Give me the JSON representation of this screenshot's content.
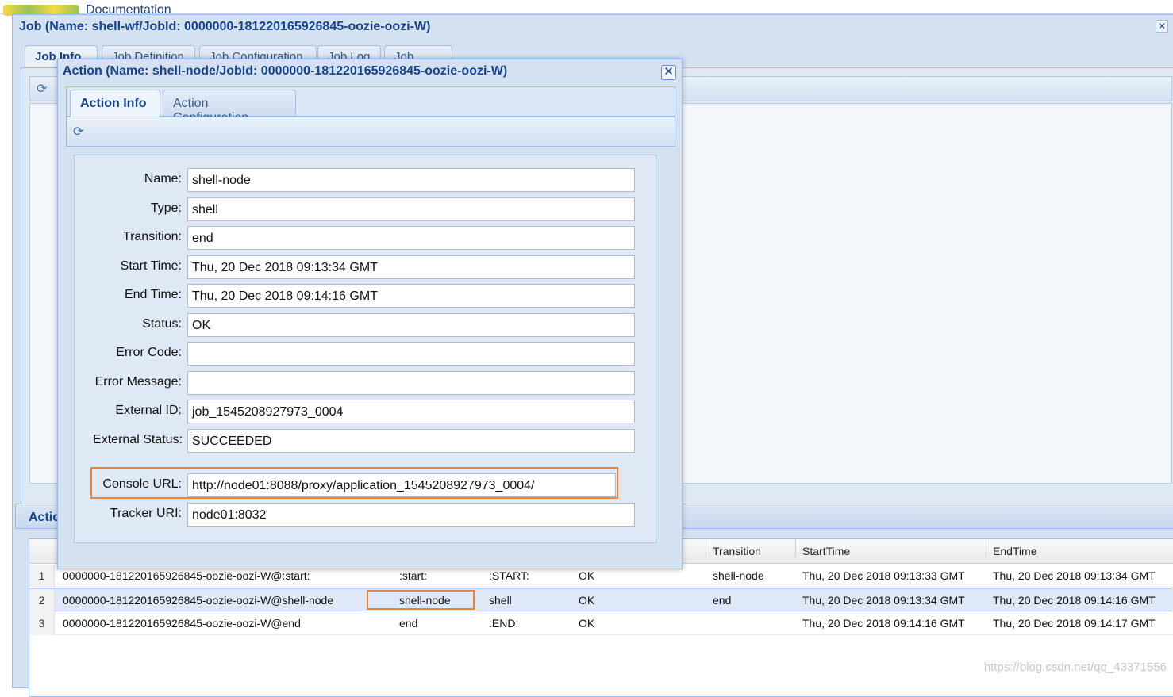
{
  "top": {
    "doc_label": "Documentation"
  },
  "job_window": {
    "title": "Job (Name: shell-wf/JobId: 0000000-181220165926845-oozie-oozi-W)",
    "tabs": [
      "Job Info",
      "Job Definition",
      "Job Configuration",
      "Job Log",
      "Job DAG"
    ],
    "active_tab": "Job Info",
    "actions_panel_title": "Actions",
    "grid": {
      "visible_columns": [
        "Transition",
        "StartTime",
        "EndTime"
      ],
      "rows": [
        {
          "n": "1",
          "id": "0000000-181220165926845-oozie-oozi-W@:start:",
          "name": ":start:",
          "type": ":START:",
          "status": "OK",
          "transition": "shell-node",
          "start": "Thu, 20 Dec 2018 09:13:33 GMT",
          "end": "Thu, 20 Dec 2018 09:13:34 GMT"
        },
        {
          "n": "2",
          "id": "0000000-181220165926845-oozie-oozi-W@shell-node",
          "name": "shell-node",
          "type": "shell",
          "status": "OK",
          "transition": "end",
          "start": "Thu, 20 Dec 2018 09:13:34 GMT",
          "end": "Thu, 20 Dec 2018 09:14:16 GMT"
        },
        {
          "n": "3",
          "id": "0000000-181220165926845-oozie-oozi-W@end",
          "name": "end",
          "type": ":END:",
          "status": "OK",
          "transition": "",
          "start": "Thu, 20 Dec 2018 09:14:16 GMT",
          "end": "Thu, 20 Dec 2018 09:14:17 GMT"
        }
      ]
    }
  },
  "action_dialog": {
    "title": "Action (Name: shell-node/JobId: 0000000-181220165926845-oozie-oozi-W)",
    "tabs": [
      "Action Info",
      "Action Configuration"
    ],
    "active_tab": "Action Info",
    "fields": [
      {
        "label": "Name:",
        "value": "shell-node"
      },
      {
        "label": "Type:",
        "value": "shell"
      },
      {
        "label": "Transition:",
        "value": "end"
      },
      {
        "label": "Start Time:",
        "value": "Thu, 20 Dec 2018 09:13:34 GMT"
      },
      {
        "label": "End Time:",
        "value": "Thu, 20 Dec 2018 09:14:16 GMT"
      },
      {
        "label": "Status:",
        "value": "OK"
      },
      {
        "label": "Error Code:",
        "value": ""
      },
      {
        "label": "Error Message:",
        "value": ""
      },
      {
        "label": "External ID:",
        "value": "job_1545208927973_0004"
      },
      {
        "label": "External Status:",
        "value": "SUCCEEDED"
      },
      {
        "label": "Console URL:",
        "value": "http://node01:8088/proxy/application_1545208927973_0004/"
      },
      {
        "label": "Tracker URI:",
        "value": "node01:8032"
      }
    ]
  },
  "highlight_color": "#ee8330",
  "watermark": "https://blog.csdn.net/qq_43371556"
}
